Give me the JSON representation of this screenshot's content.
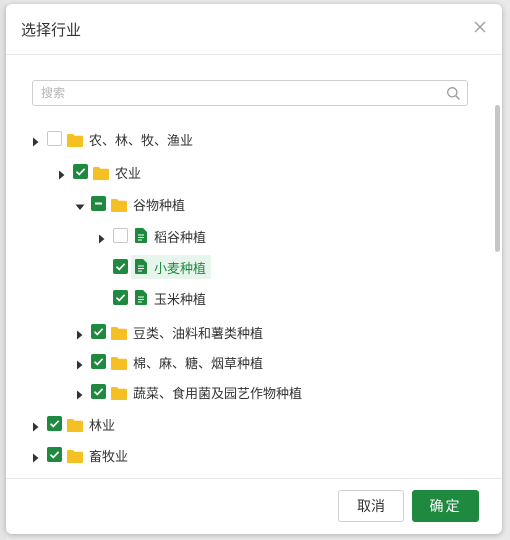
{
  "dialog": {
    "title": "选择行业",
    "close_icon": "close-icon"
  },
  "search": {
    "placeholder": "搜索",
    "value": "",
    "icon": "search-icon"
  },
  "tree": {
    "nodes": [
      {
        "label": "农、林、牧、渔业",
        "check": "unchecked",
        "expander": "collapsed",
        "icon": "folder-icon"
      },
      {
        "label": "农业",
        "check": "checked",
        "expander": "collapsed",
        "icon": "folder-icon"
      },
      {
        "label": "谷物种植",
        "check": "partial",
        "expander": "expanded",
        "icon": "folder-icon"
      },
      {
        "label": "稻谷种植",
        "check": "unchecked",
        "expander": "collapsed",
        "icon": "file-icon"
      },
      {
        "label": "小麦种植",
        "check": "checked",
        "expander": "none",
        "icon": "file-icon",
        "highlighted": true
      },
      {
        "label": "玉米种植",
        "check": "checked",
        "expander": "none",
        "icon": "file-icon"
      },
      {
        "label": "豆类、油料和薯类种植",
        "check": "checked",
        "expander": "collapsed",
        "icon": "folder-icon"
      },
      {
        "label": "棉、麻、糖、烟草种植",
        "check": "checked",
        "expander": "collapsed",
        "icon": "folder-icon"
      },
      {
        "label": "蔬菜、食用菌及园艺作物种植",
        "check": "checked",
        "expander": "collapsed",
        "icon": "folder-icon"
      },
      {
        "label": "林业",
        "check": "checked",
        "expander": "collapsed",
        "icon": "folder-icon"
      },
      {
        "label": "畜牧业",
        "check": "checked",
        "expander": "collapsed",
        "icon": "folder-icon"
      }
    ]
  },
  "footer": {
    "cancel_label": "取消",
    "ok_label": "确定"
  },
  "colors": {
    "accent": "#1f8a3f",
    "folder": "#f5c021",
    "file": "#1f8a3f",
    "highlight": "#e8f5ec"
  }
}
